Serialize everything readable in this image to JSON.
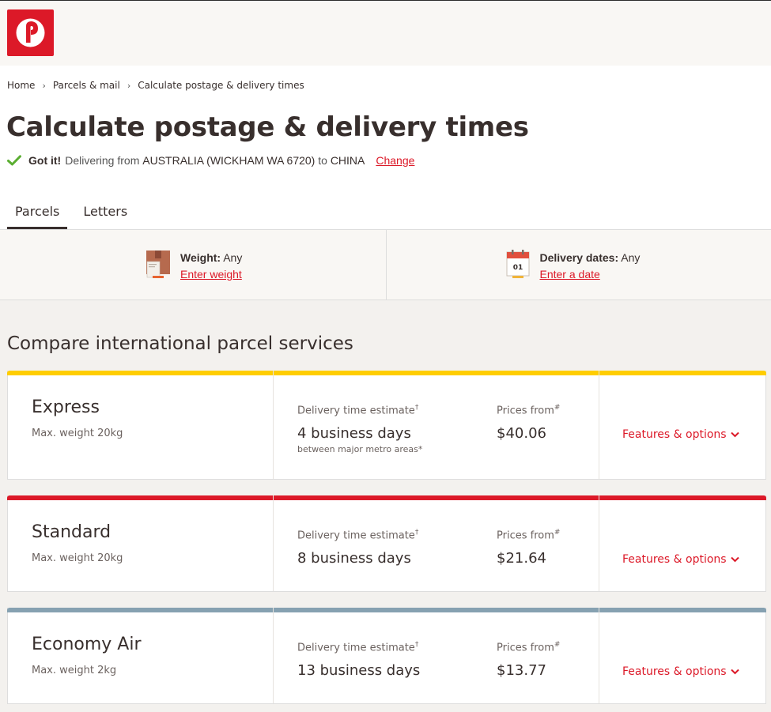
{
  "header": {
    "logo_name": "Australia Post"
  },
  "breadcrumb": {
    "items": [
      "Home",
      "Parcels & mail",
      "Calculate postage & delivery times"
    ]
  },
  "page": {
    "title": "Calculate postage & delivery times",
    "status_bold": "Got it!",
    "status_prefix": "Delivering from",
    "origin": "AUSTRALIA (WICKHAM WA 6720)",
    "to_word": "to",
    "destination": "CHINA",
    "change_label": "Change"
  },
  "tabs": [
    {
      "label": "Parcels",
      "active": true
    },
    {
      "label": "Letters",
      "active": false
    }
  ],
  "filters": {
    "weight": {
      "label": "Weight:",
      "value": "Any",
      "link": "Enter weight"
    },
    "dates": {
      "label": "Delivery dates:",
      "value": "Any",
      "link": "Enter a date",
      "calendar_day": "01"
    }
  },
  "section_title": "Compare international parcel services",
  "services": [
    {
      "name": "Express",
      "weight": "Max. weight 20kg",
      "bar_color": "#ffcd00",
      "time_label": "Delivery time estimate",
      "time_mark": "†",
      "time": "4 business days",
      "time_note": "between major metro areas*",
      "price_label": "Prices from",
      "price_mark": "#",
      "price": "$40.06",
      "features_label": "Features & options"
    },
    {
      "name": "Standard",
      "weight": "Max. weight 20kg",
      "bar_color": "#dc1928",
      "time_label": "Delivery time estimate",
      "time_mark": "†",
      "time": "8 business days",
      "price_label": "Prices from",
      "price_mark": "#",
      "price": "$21.64",
      "features_label": "Features & options"
    },
    {
      "name": "Economy Air",
      "weight": "Max. weight 2kg",
      "bar_color": "#86a1b1",
      "time_label": "Delivery time estimate",
      "time_mark": "†",
      "time": "13 business days",
      "price_label": "Prices from",
      "price_mark": "#",
      "price": "$13.77",
      "features_label": "Features & options"
    }
  ],
  "colors": {
    "brand_red": "#dc1928",
    "text": "#382f2d",
    "check_green": "#5bae32"
  }
}
